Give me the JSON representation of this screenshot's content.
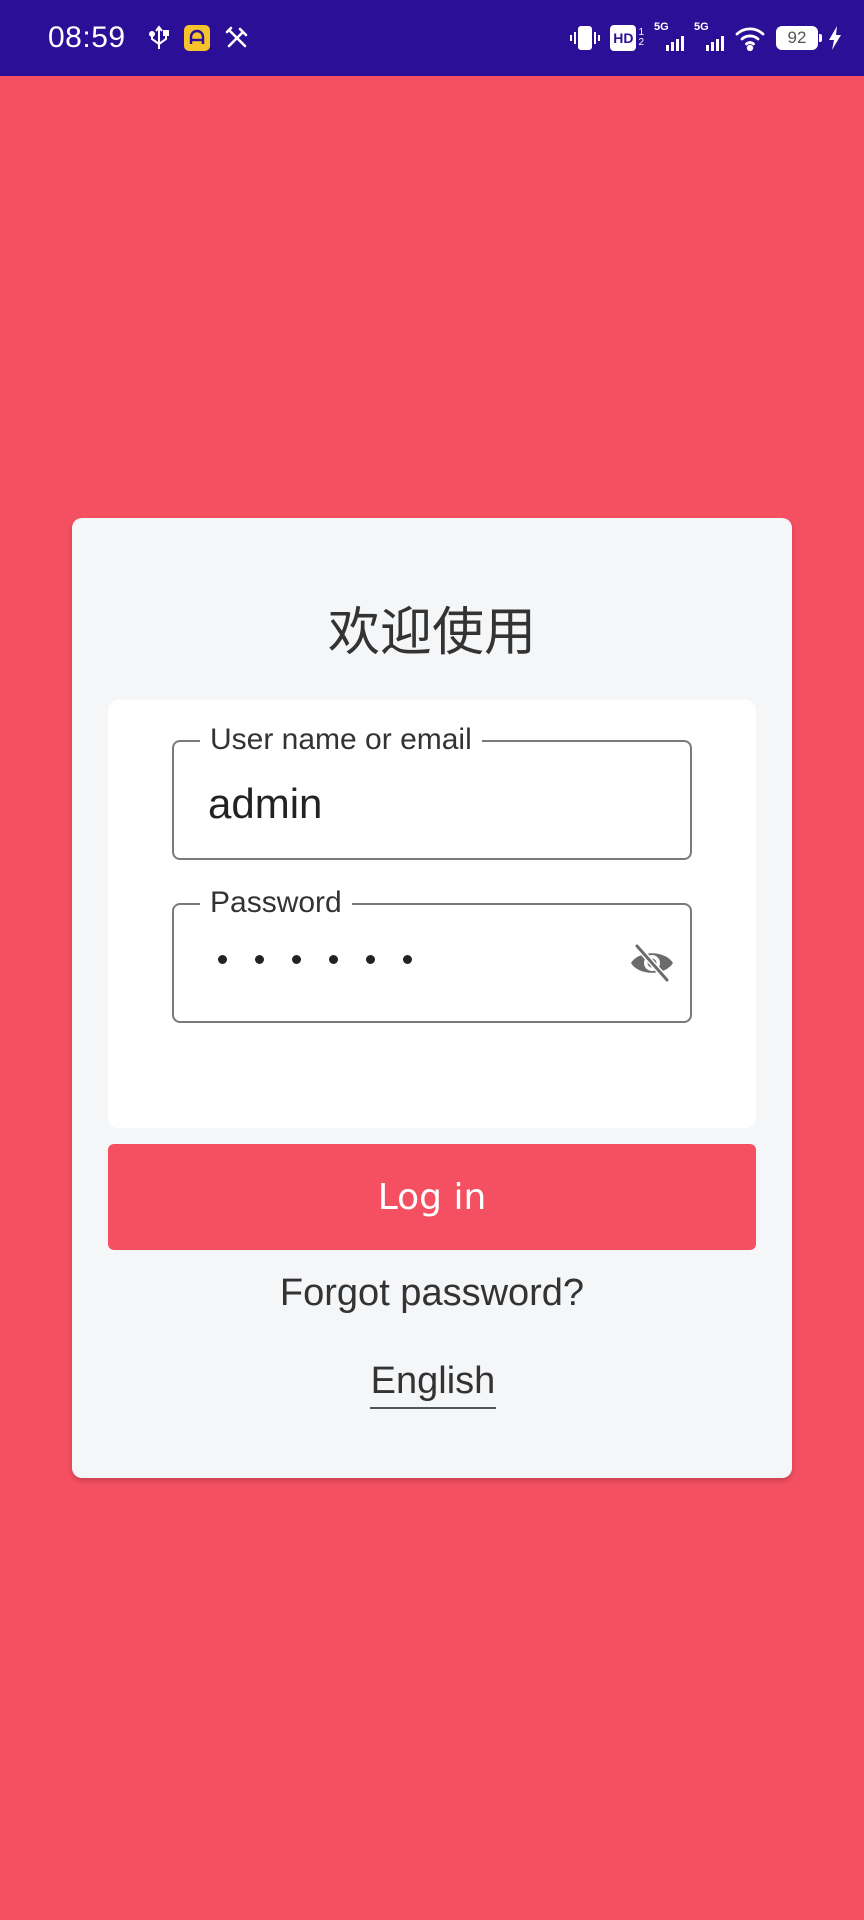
{
  "colors": {
    "status_bar_bg": "#2b0f96",
    "page_bg": "#f55061",
    "card_bg": "#f5f6f8",
    "button_bg": "#f55061"
  },
  "status_bar": {
    "time": "08:59",
    "left_icons": [
      "usb-icon",
      "app-notification-icon",
      "tools-icon"
    ],
    "right_icons": [
      "vibrate-icon",
      "hd-voice-icon",
      "signal-5g-icon",
      "signal-5g-icon",
      "wifi-icon",
      "battery-icon",
      "charging-icon"
    ],
    "hd_label": "HD",
    "hd_sub_top": "1",
    "hd_sub_bottom": "2",
    "network_1": "5G",
    "network_2": "5G",
    "battery_level": "92"
  },
  "login": {
    "title": "欢迎使用",
    "username_label": "User name or email",
    "username_value": "admin",
    "password_label": "Password",
    "password_length": 6,
    "login_button": "Log in",
    "forgot_password": "Forgot password?",
    "language": "English"
  }
}
